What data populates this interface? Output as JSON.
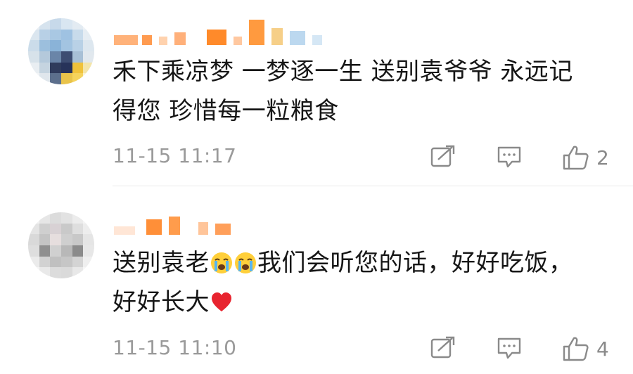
{
  "comments": [
    {
      "nickname": "",
      "text": "禾下乘凉梦 一梦逐一生 送别袁爷爷 永远记得您 珍惜每一粒粮食",
      "text_parts": [
        "禾下乘凉梦 一梦逐一生 送别袁爷爷 永远记",
        "得您 珍惜每一粒粮食"
      ],
      "time": "11-15 11:17",
      "likes": "2"
    },
    {
      "nickname": "",
      "text_before_emoji": "送别袁老",
      "text_after_emoji": "我们会听您的话，好好吃饭，",
      "text_line2": "好好长大",
      "emojis": [
        "crying-face",
        "crying-face",
        "red-heart"
      ],
      "time": "11-15 11:10",
      "likes": "4"
    }
  ],
  "icons": {
    "share": "share-icon",
    "reply": "comment-icon",
    "like": "thumbs-up-icon"
  },
  "colors": {
    "text": "#161616",
    "meta": "#9a9a9a",
    "icon": "#8a8a8a",
    "mosaic_orange": "#ff8a2a",
    "heart": "#e8242f"
  }
}
